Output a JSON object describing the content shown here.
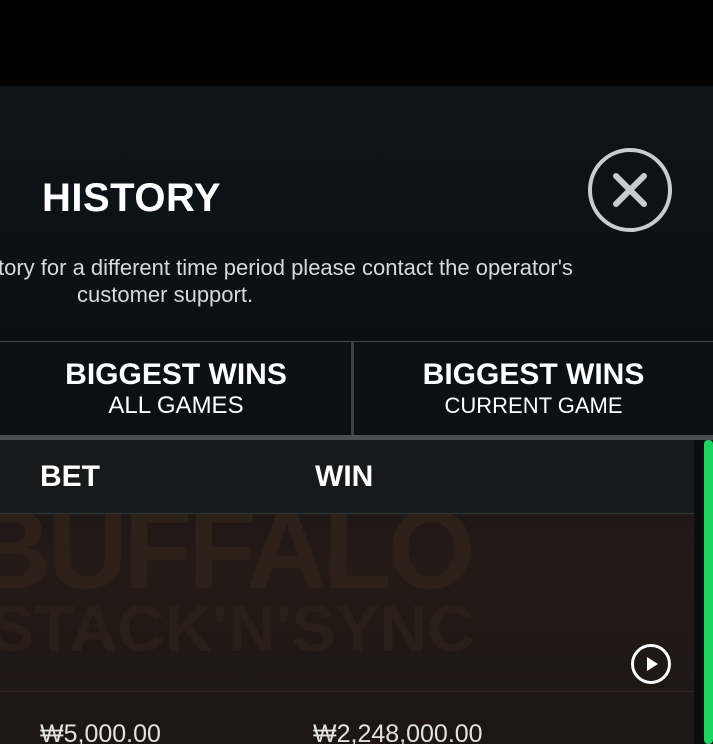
{
  "history": {
    "title": "HISTORY",
    "close_icon": "close-circle-icon",
    "notice_line1": "tory for a different time period please contact the operator's",
    "notice_line2": "customer support."
  },
  "tabs": [
    {
      "label": "BIGGEST WINS",
      "sublabel": "ALL GAMES"
    },
    {
      "label": "BIGGEST WINS",
      "sublabel": "CURRENT GAME"
    }
  ],
  "table": {
    "columns": {
      "bet": "BET",
      "win": "WIN"
    },
    "rows": [
      {
        "bet": "₩5,000.00",
        "win": "₩2,248,000.00",
        "action_icon": "play-icon"
      }
    ],
    "background_art_text": "BUFFALO",
    "background_art_text2": "STACK'N'SYNC"
  },
  "colors": {
    "scrollbar": "#1fd360",
    "panel_bg": "#0b0f12"
  }
}
